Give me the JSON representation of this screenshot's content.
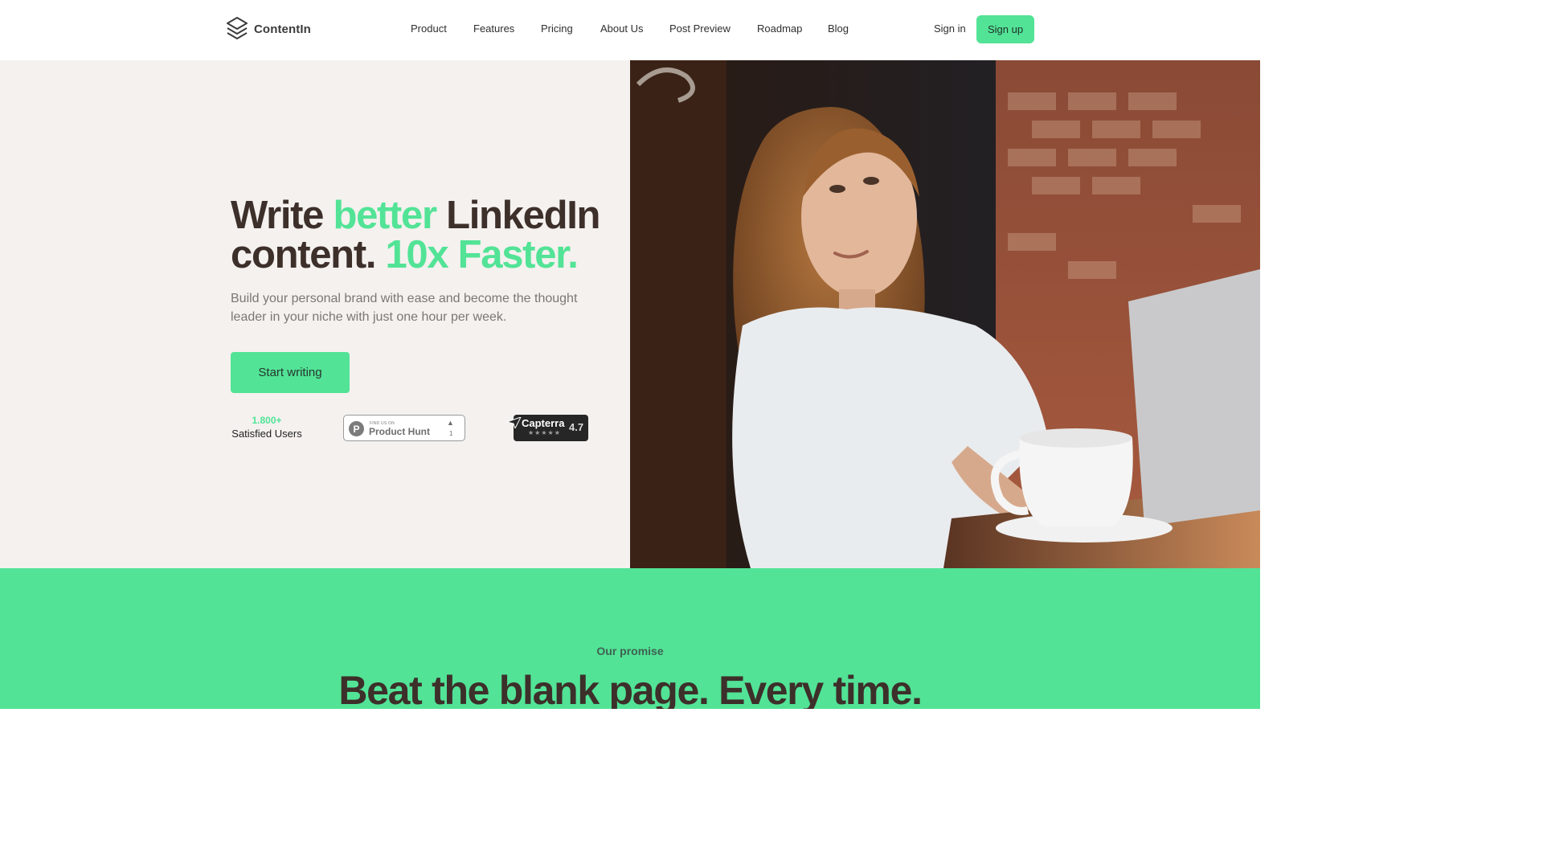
{
  "brand": {
    "name": "ContentIn",
    "logo_icon": "stacked-layers-icon"
  },
  "nav": {
    "links": [
      "Product",
      "Features",
      "Pricing",
      "About Us",
      "Post Preview",
      "Roadmap",
      "Blog"
    ],
    "signin_label": "Sign in",
    "signup_label": "Sign up"
  },
  "hero": {
    "headline": {
      "part1": "Write ",
      "accent1": "better",
      "part2": " LinkedIn content. ",
      "accent2": "10x Faster."
    },
    "subtext": "Build your personal brand with ease and become the thought leader in your niche with just one hour per week.",
    "cta_label": "Start writing",
    "stat": {
      "value": "1.800+",
      "label": "Satisfied Users"
    },
    "product_hunt": {
      "eyebrow": "FIND US ON",
      "name": "Product Hunt",
      "upvotes": "1",
      "arrow": "▲",
      "letter": "P"
    },
    "capterra": {
      "name": "Capterra",
      "rating": "4.7",
      "stars": "★★★★★"
    },
    "photo": {
      "icon": "photo-woman-laptop-cafe"
    }
  },
  "promise": {
    "eyebrow": "Our promise",
    "title": "Beat the blank page. Every time."
  },
  "colors": {
    "accent": "#52e396",
    "heading": "#3d2f2a",
    "hero_bg": "#f4f1ee",
    "badge_dark": "#262626"
  }
}
